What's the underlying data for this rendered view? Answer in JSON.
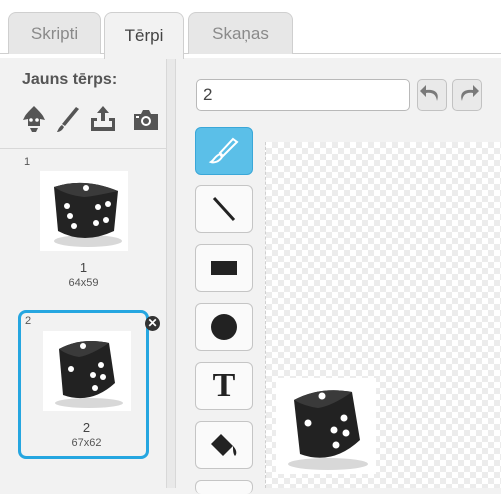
{
  "tabs": [
    {
      "label": "Skripti"
    },
    {
      "label": "Tērpi"
    },
    {
      "label": "Skaņas"
    }
  ],
  "costumes_pane": {
    "new_costume_label": "Jauns tērps:",
    "icons": [
      "costume-library-icon",
      "paint-brush-icon",
      "upload-icon",
      "camera-icon"
    ],
    "items": [
      {
        "index": "1",
        "name": "1",
        "size": "64x59"
      },
      {
        "index": "2",
        "name": "2",
        "size": "67x62"
      }
    ],
    "delete_glyph": "✕"
  },
  "editor": {
    "costume_name_value": "2",
    "tools": [
      "brush-tool-icon",
      "line-tool-icon",
      "rectangle-tool-icon",
      "ellipse-tool-icon",
      "text-tool-icon",
      "fill-tool-icon"
    ],
    "text_tool_glyph": "T"
  },
  "colors": {
    "selection_blue": "#26a6e0",
    "active_tool": "#5bbfe8"
  }
}
